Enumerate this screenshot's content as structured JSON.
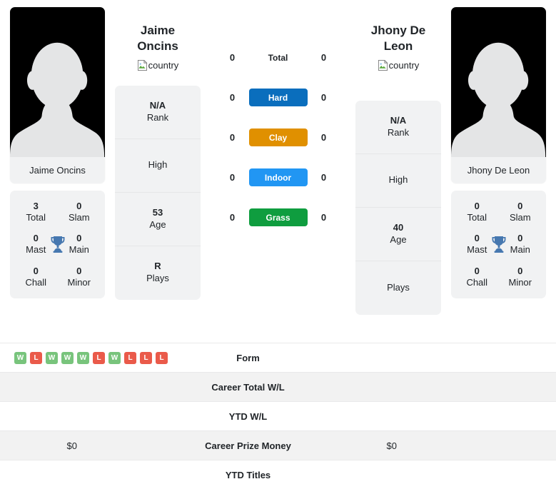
{
  "players": {
    "left": {
      "name": "Jaime Oncins",
      "name_line1": "Jaime",
      "name_line2": "Oncins",
      "country_alt": "country",
      "photo_caption": "Jaime Oncins",
      "titles": {
        "total_value": "3",
        "total_label": "Total",
        "slam_value": "0",
        "slam_label": "Slam",
        "mast_value": "0",
        "mast_label": "Mast",
        "main_value": "0",
        "main_label": "Main",
        "chall_value": "0",
        "chall_label": "Chall",
        "minor_value": "0",
        "minor_label": "Minor"
      },
      "info": {
        "rank_value": "N/A",
        "rank_label": "Rank",
        "high_value": "",
        "high_label": "High",
        "age_value": "53",
        "age_label": "Age",
        "plays_value": "R",
        "plays_label": "Plays"
      }
    },
    "right": {
      "name": "Jhony De Leon",
      "name_line1": "Jhony De",
      "name_line2": "Leon",
      "country_alt": "country",
      "photo_caption": "Jhony De Leon",
      "titles": {
        "total_value": "0",
        "total_label": "Total",
        "slam_value": "0",
        "slam_label": "Slam",
        "mast_value": "0",
        "mast_label": "Mast",
        "main_value": "0",
        "main_label": "Main",
        "chall_value": "0",
        "chall_label": "Chall",
        "minor_value": "0",
        "minor_label": "Minor"
      },
      "info": {
        "rank_value": "N/A",
        "rank_label": "Rank",
        "high_value": "",
        "high_label": "High",
        "age_value": "40",
        "age_label": "Age",
        "plays_value": "",
        "plays_label": "Plays"
      }
    }
  },
  "surfaces": [
    {
      "label": "Total",
      "left": "0",
      "right": "0",
      "color": "",
      "badge": false
    },
    {
      "label": "Hard",
      "left": "0",
      "right": "0",
      "color": "#0a6ebd",
      "badge": true
    },
    {
      "label": "Clay",
      "left": "0",
      "right": "0",
      "color": "#e09000",
      "badge": true
    },
    {
      "label": "Indoor",
      "left": "0",
      "right": "0",
      "color": "#2196f3",
      "badge": true
    },
    {
      "label": "Grass",
      "left": "0",
      "right": "0",
      "color": "#0f9d3f",
      "badge": true
    }
  ],
  "table": [
    {
      "label": "Form",
      "left": "",
      "right": "",
      "form": [
        "W",
        "L",
        "W",
        "W",
        "W",
        "L",
        "W",
        "L",
        "L",
        "L"
      ]
    },
    {
      "label": "Career Total W/L",
      "left": "",
      "right": ""
    },
    {
      "label": "YTD W/L",
      "left": "",
      "right": ""
    },
    {
      "label": "Career Prize Money",
      "left": "$0",
      "right": "$0"
    },
    {
      "label": "YTD Titles",
      "left": "",
      "right": ""
    }
  ],
  "colors": {
    "win": "#78c47c",
    "loss": "#ea5a4a",
    "trophy": "#4678b0",
    "card_bg": "#f1f2f3",
    "row_alt_bg": "#f2f2f2"
  }
}
